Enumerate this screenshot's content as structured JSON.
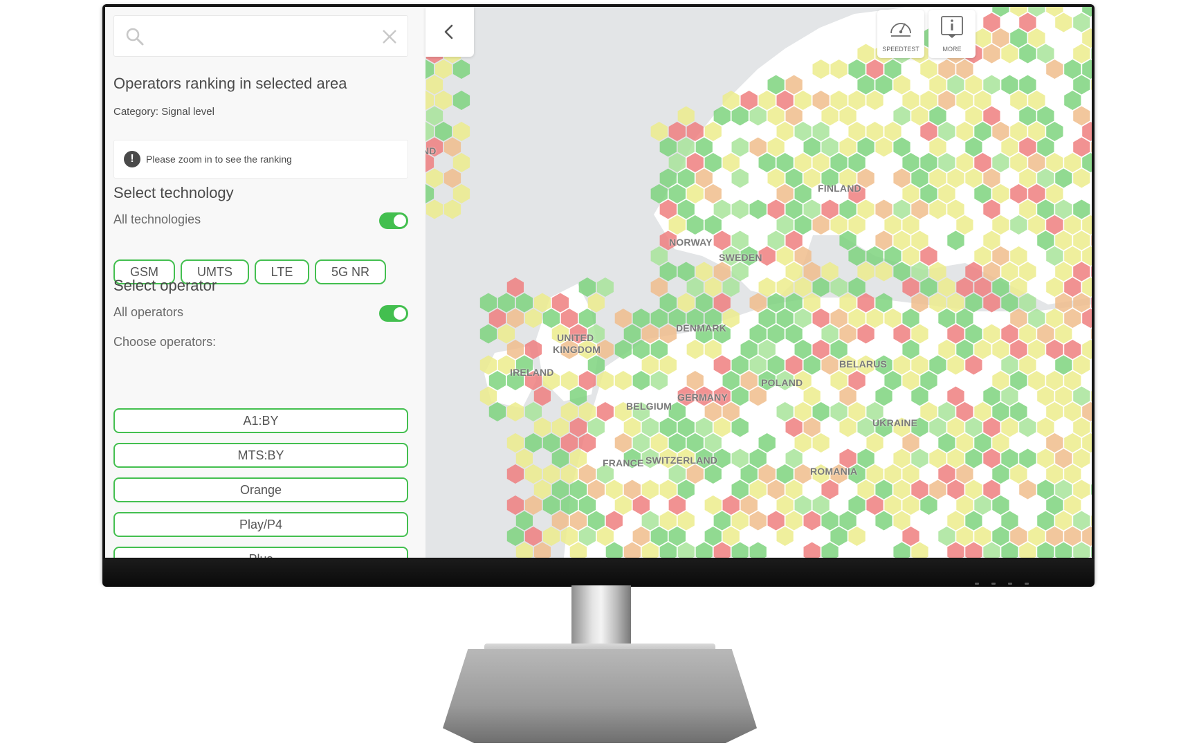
{
  "sidebar": {
    "search": {
      "placeholder": "",
      "value": ""
    },
    "ranking_title": "Operators ranking in selected area",
    "category": "Category: Signal level",
    "notice": "Please zoom in to see the ranking",
    "technology": {
      "title": "Select technology",
      "all_label": "All technologies",
      "all_enabled": true,
      "options": [
        "GSM",
        "UMTS",
        "LTE",
        "5G NR"
      ]
    },
    "operator": {
      "title": "Select operator",
      "all_label": "All operators",
      "all_enabled": true,
      "choose_label": "Choose operators:",
      "options": [
        "A1:BY",
        "MTS:BY",
        "Orange",
        "Play/P4",
        "Plus"
      ]
    }
  },
  "map": {
    "countries": {
      "iceland": "ICELAND",
      "finland": "FINLAND",
      "norway": "NORWAY",
      "sweden": "SWEDEN",
      "denmark": "DENMARK",
      "united_kingdom_1": "UNITED",
      "united_kingdom_2": "KINGDOM",
      "ireland": "IRELAND",
      "belarus": "BELARUS",
      "poland": "POLAND",
      "belgium": "BELGIUM",
      "germany": "GERMANY",
      "ukraine": "UKRAINE",
      "france": "FRANCE",
      "switzerland": "SWITZERLAND",
      "romania": "ROMANIA"
    },
    "hex_colors": {
      "green": "#7ed37e",
      "light_green": "#a8e49a",
      "yellow": "#ecec8c",
      "orange": "#f0bd8c",
      "red": "#ef7f7f"
    },
    "land_color": "#ffffff",
    "sea_color": "#e3e5e7"
  },
  "toolbar": {
    "speedtest_label": "SPEEDTEST",
    "more_label": "MORE",
    "speedtest_icon": "speedometer-icon",
    "more_icon": "info-icon"
  },
  "colors": {
    "accent": "#43bf4f",
    "text": "#4a4a4a"
  }
}
